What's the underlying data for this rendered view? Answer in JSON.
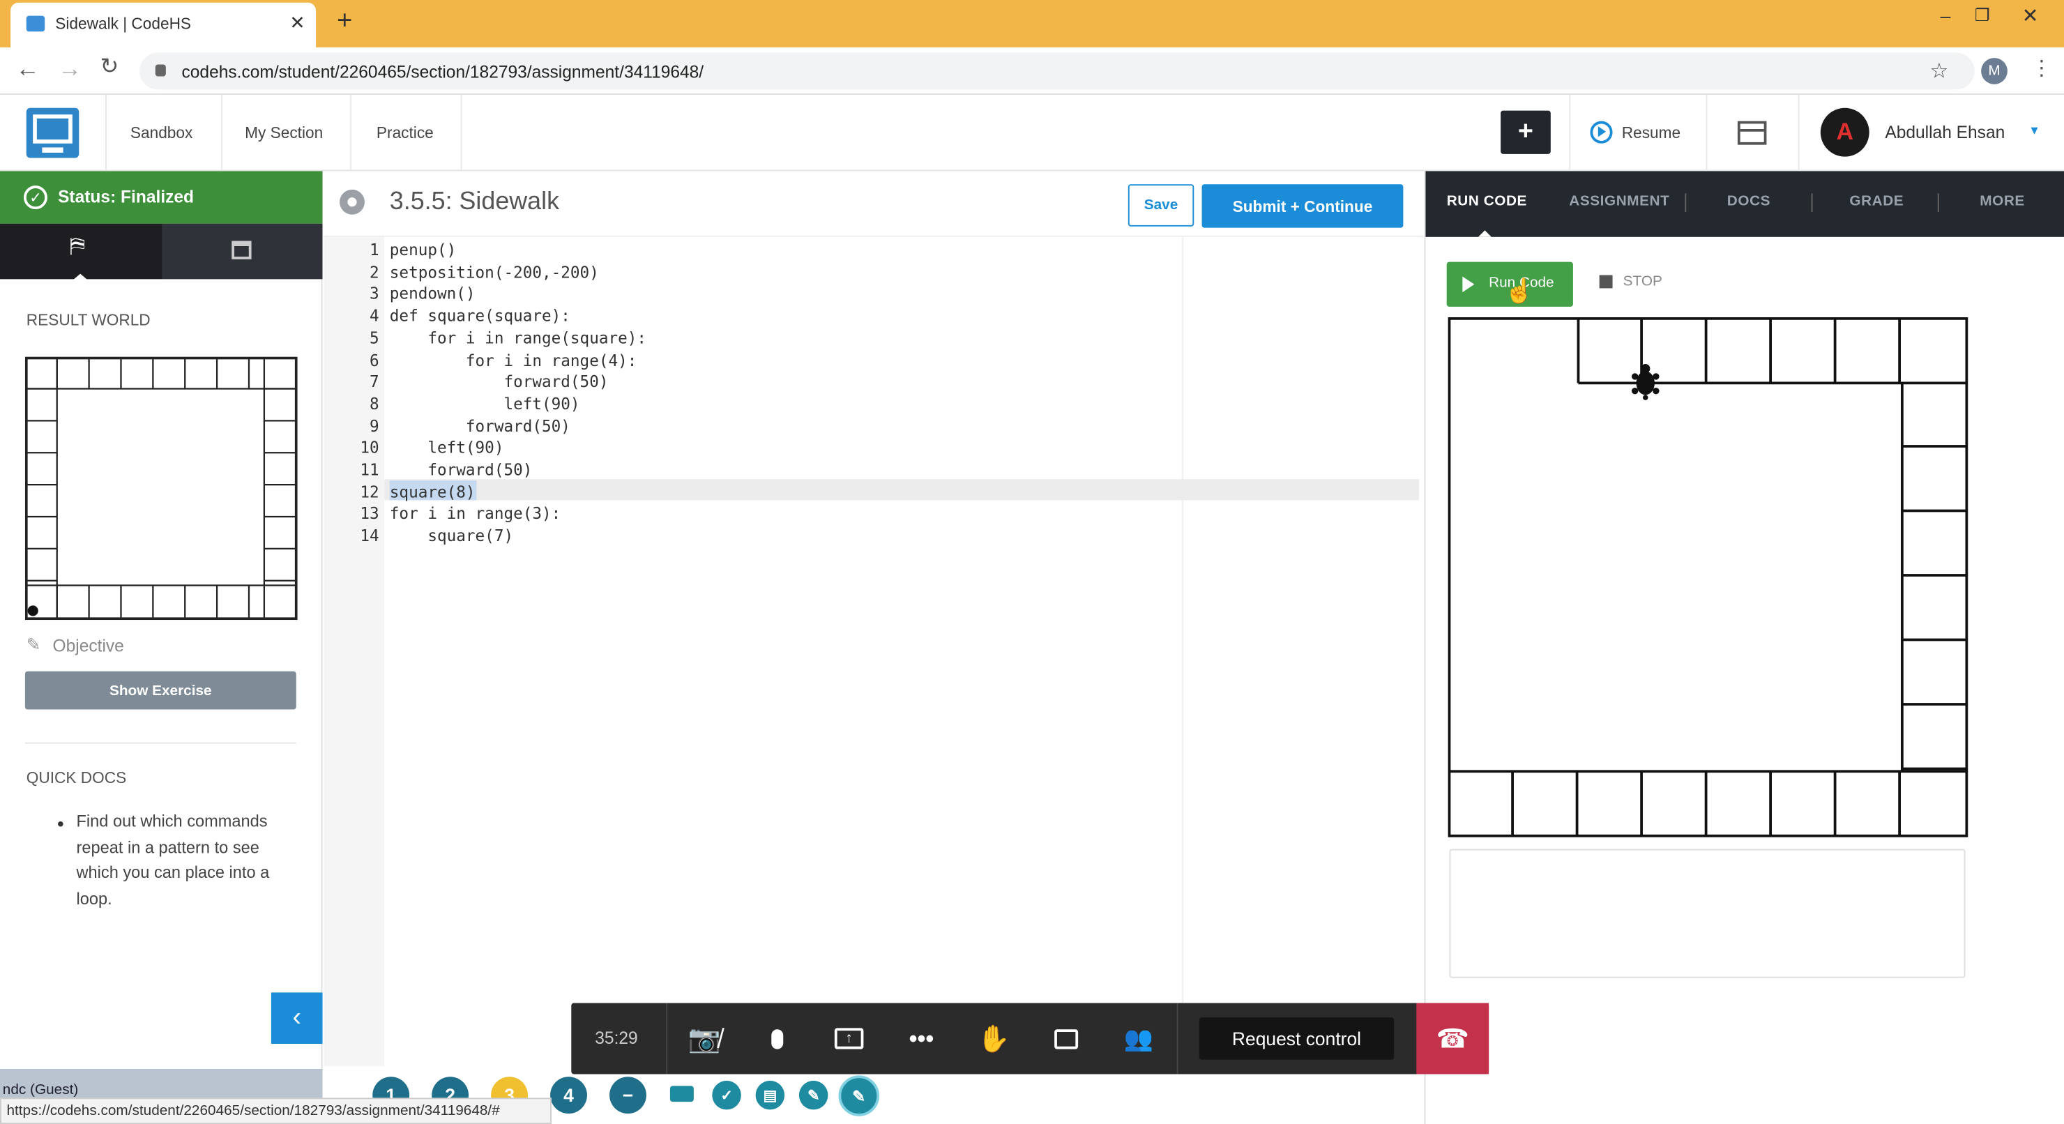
{
  "browser": {
    "tab_title": "Sidewalk | CodeHS",
    "url": "codehs.com/student/2260465/section/182793/assignment/34119648/",
    "profile_initial": "M",
    "status_url": "https://codehs.com/student/2260465/section/182793/assignment/34119648/#"
  },
  "header": {
    "nav": [
      "Sandbox",
      "My Section",
      "Practice"
    ],
    "plus_label": "+",
    "resume_label": "Resume",
    "user_name": "Abdullah Ehsan"
  },
  "left": {
    "status": "Status: Finalized",
    "result_world_label": "RESULT WORLD",
    "objective_label": "Objective",
    "show_exercise_label": "Show Exercise",
    "quick_docs_label": "QUICK DOCS",
    "quick_docs_text": "Find out which commands repeat in a pattern to see which you can place into a loop."
  },
  "editor": {
    "title": "3.5.5: Sidewalk",
    "save_label": "Save",
    "submit_label": "Submit + Continue",
    "lines": [
      "penup()",
      "setposition(-200,-200)",
      "pendown()",
      "def square(square):",
      "    for i in range(square):",
      "        for i in range(4):",
      "            forward(50)",
      "            left(90)",
      "        forward(50)",
      "    left(90)",
      "    forward(50)",
      "square(8)",
      "for i in range(3):",
      "    square(7)"
    ],
    "line_numbers": [
      "1",
      "2",
      "3",
      "4",
      "5",
      "6",
      "7",
      "8",
      "9",
      "10",
      "11",
      "12",
      "13",
      "14"
    ]
  },
  "right": {
    "tabs": [
      "RUN CODE",
      "ASSIGNMENT",
      "DOCS",
      "GRADE",
      "MORE"
    ],
    "run_label": "Run Code",
    "stop_label": "STOP"
  },
  "meeting": {
    "timer": "35:29",
    "request_control_label": "Request control"
  },
  "bottom": {
    "guest_text": "ndc (Guest)",
    "pills": [
      "1",
      "2",
      "3",
      "4"
    ]
  },
  "colors": {
    "accent_blue": "#1a8cd8",
    "status_green": "#3d8f3a",
    "run_green": "#44a047",
    "chrome_orange": "#f1b548",
    "hangup_red": "#c4314b"
  }
}
